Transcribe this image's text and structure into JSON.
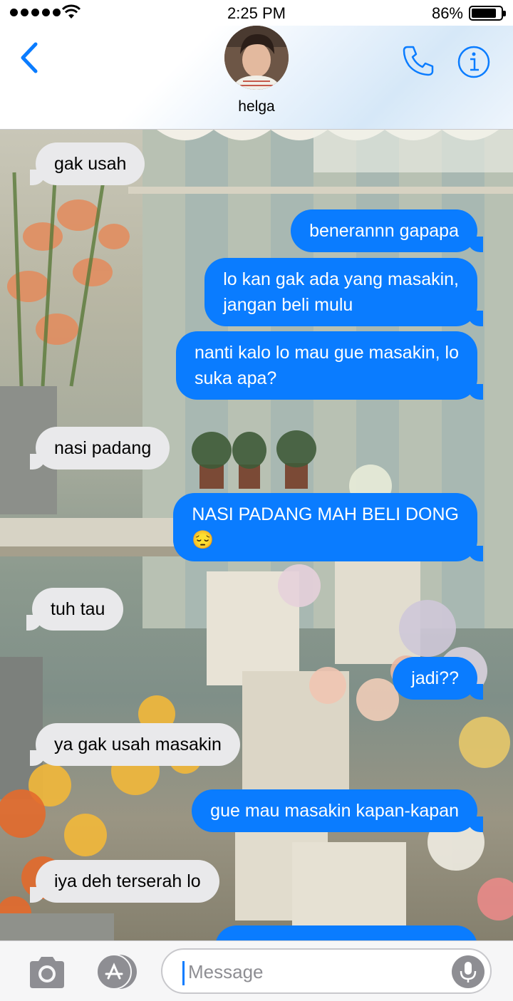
{
  "status_bar": {
    "time": "2:25 PM",
    "battery_percent": "86%",
    "battery_level": 0.86,
    "signal_bars": 5
  },
  "header": {
    "contact_name": "helga",
    "back_icon": "chevron-left-icon",
    "call_icon": "phone-icon",
    "info_icon": "info-icon",
    "accent_color": "#0a7cff"
  },
  "messages": [
    {
      "direction": "incoming",
      "lines": [
        "gak usah"
      ]
    },
    {
      "direction": "outgoing",
      "lines": [
        "benerannn gapapa"
      ]
    },
    {
      "direction": "outgoing",
      "lines": [
        "lo kan gak ada yang masakin,",
        "jangan beli mulu"
      ]
    },
    {
      "direction": "outgoing",
      "lines": [
        "nanti kalo lo mau gue masakin, lo",
        "suka apa?"
      ]
    },
    {
      "direction": "incoming",
      "lines": [
        "nasi padang"
      ]
    },
    {
      "direction": "outgoing",
      "lines": [
        "NASI PADANG MAH BELI DONG",
        "😔"
      ]
    },
    {
      "direction": "incoming",
      "lines": [
        "tuh tau"
      ]
    },
    {
      "direction": "outgoing",
      "lines": [
        "jadi??"
      ]
    },
    {
      "direction": "incoming",
      "lines": [
        "ya gak usah masakin"
      ]
    },
    {
      "direction": "outgoing",
      "lines": [
        "gue mau masakin kapan-kapan"
      ]
    },
    {
      "direction": "incoming",
      "lines": [
        "iya deh terserah lo"
      ]
    },
    {
      "direction": "outgoing",
      "lines": [
        ""
      ]
    }
  ],
  "input_bar": {
    "placeholder": "Message",
    "camera_icon": "camera-icon",
    "apps_icon": "app-store-icon",
    "mic_icon": "microphone-icon"
  },
  "colors": {
    "outgoing_bubble": "#0a7cff",
    "incoming_bubble": "#e9e9eb"
  }
}
